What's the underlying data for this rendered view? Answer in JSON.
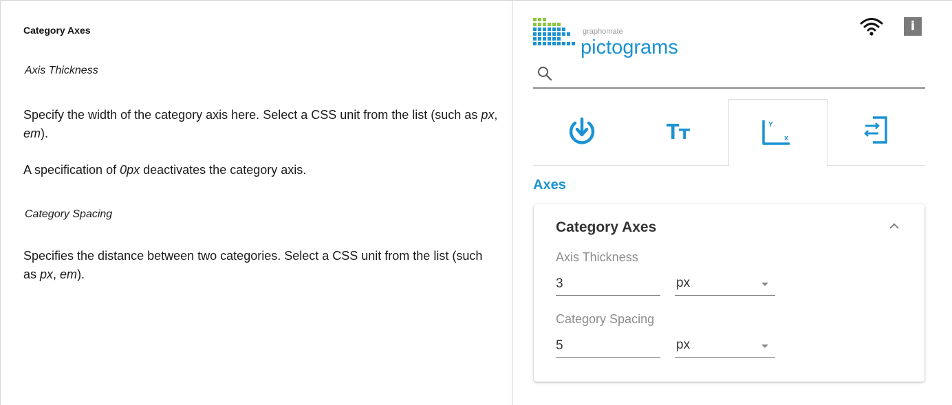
{
  "doc": {
    "title": "Category Axes",
    "axis_thickness_heading": "Axis Thickness",
    "p1_a": "Specify the width of the category axis here. Select a CSS unit from the list (such as ",
    "p1_px": "px",
    "p1_sep": ", ",
    "p1_em": "em",
    "p1_end": ").",
    "p2_a": "A specification of ",
    "p2_i": "0px",
    "p2_b": " deactivates the category axis.",
    "category_spacing_heading": "Category Spacing",
    "p3_a": "Specifies the distance between two categories. Select a CSS unit from the list (such as ",
    "p3_px": "px",
    "p3_sep": ", ",
    "p3_em": "em",
    "p3_end": ")."
  },
  "app": {
    "brand_small": "graphomate",
    "brand_big": "pictograms",
    "info_label": "i",
    "brand_color": "#1b93d2",
    "search": {
      "value": "",
      "placeholder": "",
      "icon": "search-icon"
    },
    "tabs": [
      {
        "icon": "data-import-icon",
        "active": false
      },
      {
        "icon": "text-size-icon",
        "active": false
      },
      {
        "icon": "axes-icon",
        "active": true
      },
      {
        "icon": "layout-icon",
        "active": false
      }
    ],
    "section_title": "Axes",
    "card": {
      "title": "Category Axes",
      "axis_thickness": {
        "label": "Axis Thickness",
        "value": "3",
        "unit": "px"
      },
      "category_spacing": {
        "label": "Category Spacing",
        "value": "5",
        "unit": "px"
      }
    }
  }
}
